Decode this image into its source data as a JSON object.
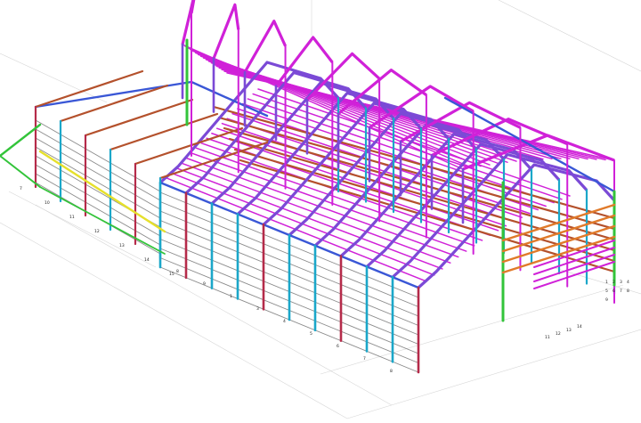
{
  "model": {
    "background": "#ffffff",
    "colors": {
      "column_cyan": "#1ba7c9",
      "column_red": "#b52b4a",
      "rafter_purple": "#7b4ad6",
      "purlin_magenta": "#d021d8",
      "bracing_brown": "#b4512c",
      "eaves_blue": "#3a57d6",
      "girt_grey": "#8a8a8a",
      "green_member": "#33c43a",
      "yellow_member": "#e6e02c",
      "orange_beam": "#e07a2a",
      "grid_line": "#d7d7d7"
    }
  },
  "grid_labels": {
    "left_side": [
      "7",
      "10",
      "11",
      "12",
      "13",
      "14",
      "15"
    ],
    "front_side": [
      "8",
      "9",
      "1",
      "3",
      "4",
      "5",
      "6",
      "7",
      "8"
    ],
    "right_side": [
      "1",
      "2",
      "3",
      "4",
      "5",
      "6",
      "7",
      "8",
      "9"
    ],
    "corner": [
      "11",
      "12",
      "13",
      "14"
    ]
  }
}
